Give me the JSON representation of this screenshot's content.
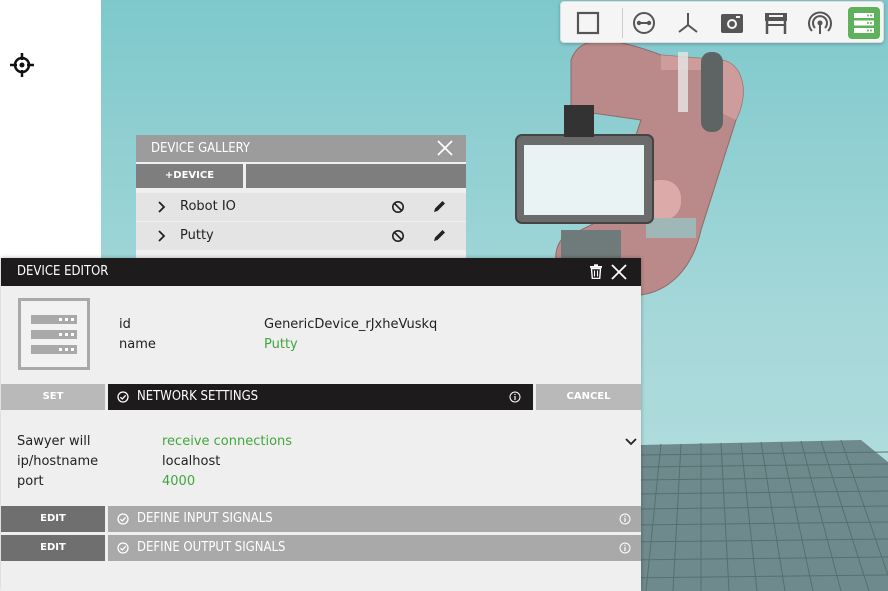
{
  "toolbar": {
    "buttons": [
      {
        "icon": "square-select-icon"
      },
      {
        "icon": "link-node-icon"
      },
      {
        "icon": "axes-icon"
      },
      {
        "icon": "camera-icon"
      },
      {
        "icon": "table-icon"
      },
      {
        "icon": "signal-icon"
      },
      {
        "icon": "server-list-icon",
        "active": true
      }
    ],
    "active_color": "#5fb25b"
  },
  "gallery": {
    "title": "DEVICE GALLERY",
    "add_label": "+DEVICE",
    "devices": [
      {
        "name": "Robot IO"
      },
      {
        "name": "Putty"
      }
    ]
  },
  "editor": {
    "title": "DEVICE EDITOR",
    "props": {
      "id_label": "id",
      "id_value": "GenericDevice_rJxheVuskq",
      "name_label": "name",
      "name_value": "Putty"
    },
    "network": {
      "set_label": "SET",
      "title": "NETWORK SETTINGS",
      "cancel_label": "CANCEL",
      "rows": [
        {
          "label": "Sawyer will",
          "value": "receive connections",
          "highlight": true
        },
        {
          "label": "ip/hostname",
          "value": "localhost",
          "highlight": false
        },
        {
          "label": "port",
          "value": "4000",
          "highlight": true
        }
      ]
    },
    "input_signals": {
      "edit_label": "EDIT",
      "title": "DEFINE INPUT SIGNALS"
    },
    "output_signals": {
      "edit_label": "EDIT",
      "title": "DEFINE OUTPUT SIGNALS"
    }
  },
  "colors": {
    "accent_green": "#41a63c",
    "editor_header": "#1d1b1b",
    "viewport_sky": "#9fd5d7",
    "robot_red": "#c98a8a"
  }
}
